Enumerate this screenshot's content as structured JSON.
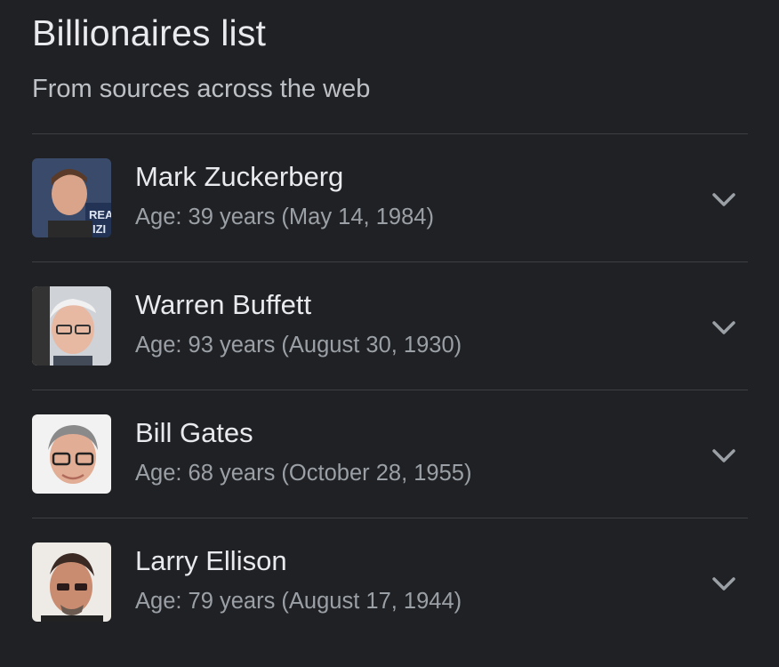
{
  "header": {
    "title": "Billionaires list",
    "subtitle": "From sources across the web"
  },
  "people": [
    {
      "name": "Mark Zuckerberg",
      "detail": "Age: 39 years (May 14, 1984)"
    },
    {
      "name": "Warren Buffett",
      "detail": "Age: 93 years (August 30, 1930)"
    },
    {
      "name": "Bill Gates",
      "detail": "Age: 68 years (October 28, 1955)"
    },
    {
      "name": "Larry Ellison",
      "detail": "Age: 79 years (August 17, 1944)"
    }
  ],
  "icons": {
    "expand": "chevron-down-icon"
  },
  "colors": {
    "background": "#202124",
    "divider": "#3c4043",
    "primary_text": "#e8eaed",
    "secondary_text": "#9aa0a6",
    "chevron": "#9aa0a6"
  }
}
